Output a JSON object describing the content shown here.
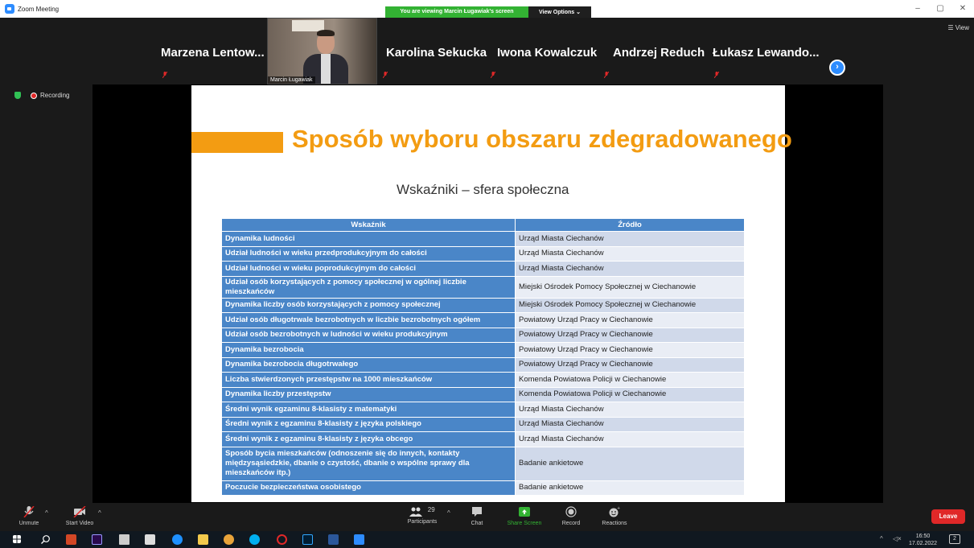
{
  "window": {
    "app_title": "Zoom Meeting",
    "viewing_banner": "You are viewing Marcin Ługawiak's screen",
    "view_options": "View Options ⌄",
    "view_button": "☰ View",
    "minimize": "–",
    "restore": "▢",
    "close": "✕"
  },
  "gallery": {
    "participants": [
      {
        "name": "Marzena Lentow..."
      },
      {
        "name": "Karolina Sekucka"
      },
      {
        "name": "Iwona Kowalczuk"
      },
      {
        "name": "Andrzej Reduch"
      },
      {
        "name": "Łukasz Lewando..."
      }
    ],
    "active_speaker": "Marcin Ługawiak",
    "next_icon": "›"
  },
  "recording": {
    "label": "Recording"
  },
  "slide": {
    "title": "Sposób wyboru obszaru zdegradowanego",
    "subtitle": "Wskaźniki – sfera społeczna",
    "table": {
      "headers": [
        "Wskaźnik",
        "Źródło"
      ],
      "rows": [
        {
          "indicator": "Dynamika ludności",
          "source": "Urząd Miasta Ciechanów"
        },
        {
          "indicator": "Udział ludności w wieku przedprodukcyjnym do całości",
          "source": "Urząd Miasta Ciechanów"
        },
        {
          "indicator": "Udział ludności w wieku poprodukcyjnym do całości",
          "source": "Urząd Miasta Ciechanów"
        },
        {
          "indicator": "Udział osób korzystających z pomocy społecznej w ogólnej liczbie mieszkańców",
          "source": "Miejski Ośrodek Pomocy Społecznej w Ciechanowie"
        },
        {
          "indicator": "Dynamika liczby osób korzystających z pomocy społecznej",
          "source": "Miejski Ośrodek Pomocy Społecznej w Ciechanowie"
        },
        {
          "indicator": "Udział osób długotrwale bezrobotnych w liczbie bezrobotnych ogółem",
          "source": "Powiatowy Urząd Pracy w Ciechanowie"
        },
        {
          "indicator": "Udział osób bezrobotnych w ludności w wieku produkcyjnym",
          "source": "Powiatowy Urząd Pracy w Ciechanowie"
        },
        {
          "indicator": "Dynamika bezrobocia",
          "source": "Powiatowy Urząd Pracy w Ciechanowie"
        },
        {
          "indicator": "Dynamika bezrobocia długotrwałego",
          "source": "Powiatowy Urząd Pracy w Ciechanowie"
        },
        {
          "indicator": "Liczba stwierdzonych przestępstw na 1000 mieszkańców",
          "source": "Komenda Powiatowa Policji w Ciechanowie"
        },
        {
          "indicator": "Dynamika liczby przestępstw",
          "source": "Komenda Powiatowa Policji w Ciechanowie"
        },
        {
          "indicator": "Średni wynik egzaminu 8-klasisty z matematyki",
          "source": "Urząd Miasta Ciechanów"
        },
        {
          "indicator": "Średni wynik z egzaminu 8-klasisty z języka polskiego",
          "source": "Urząd Miasta Ciechanów"
        },
        {
          "indicator": "Średni wynik z egzaminu 8-klasisty z języka obcego",
          "source": "Urząd Miasta Ciechanów"
        },
        {
          "indicator": "Sposób bycia mieszkańców (odnoszenie się do innych, kontakty międzysąsiedzkie, dbanie o czystość, dbanie o wspólne sprawy dla mieszkańców itp.)",
          "source": "Badanie ankietowe"
        },
        {
          "indicator": "Poczucie bezpieczeństwa osobistego",
          "source": "Badanie ankietowe"
        }
      ]
    }
  },
  "toolbar": {
    "unmute": "Unmute",
    "start_video": "Start Video",
    "participants": "Participants",
    "participants_count": "29",
    "chat": "Chat",
    "share_screen": "Share Screen",
    "record": "Record",
    "reactions": "Reactions",
    "leave": "Leave"
  },
  "taskbar": {
    "time": "16:50",
    "date": "17.02.2022",
    "notifications": "2"
  },
  "colors": {
    "accent_orange": "#f39c12",
    "table_blue": "#4a86c8",
    "zoom_blue": "#2d8cff",
    "leave_red": "#e02828",
    "share_green": "#33b233"
  }
}
